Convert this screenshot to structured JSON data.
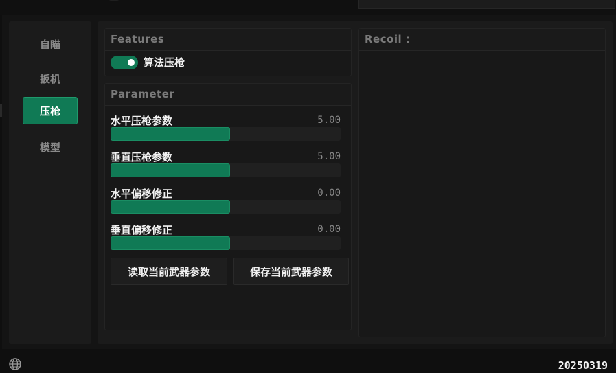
{
  "sidebar": {
    "items": [
      {
        "label": "自瞄",
        "active": false
      },
      {
        "label": "扳机",
        "active": false
      },
      {
        "label": "压枪",
        "active": true
      },
      {
        "label": "模型",
        "active": false
      }
    ]
  },
  "features": {
    "title": "Features",
    "toggle_label": "算法压枪",
    "toggle_on": true
  },
  "parameter": {
    "title": "Parameter",
    "items": [
      {
        "name": "水平压枪参数",
        "value": "5.00",
        "fill_fraction": 0.52
      },
      {
        "name": "垂直压枪参数",
        "value": "5.00",
        "fill_fraction": 0.52
      },
      {
        "name": "水平偏移修正",
        "value": "0.00",
        "fill_fraction": 0.52
      },
      {
        "name": "垂直偏移修正",
        "value": "0.00",
        "fill_fraction": 0.52
      }
    ],
    "buttons": {
      "read": "读取当前武器参数",
      "save": "保存当前武器参数"
    }
  },
  "recoil": {
    "title": "Recoil :"
  },
  "footer": {
    "version": "20250319",
    "globe_icon": "globe-icon"
  },
  "colors": {
    "accent": "#107a55",
    "background": "#141414",
    "panel": "#1b1b1b"
  }
}
